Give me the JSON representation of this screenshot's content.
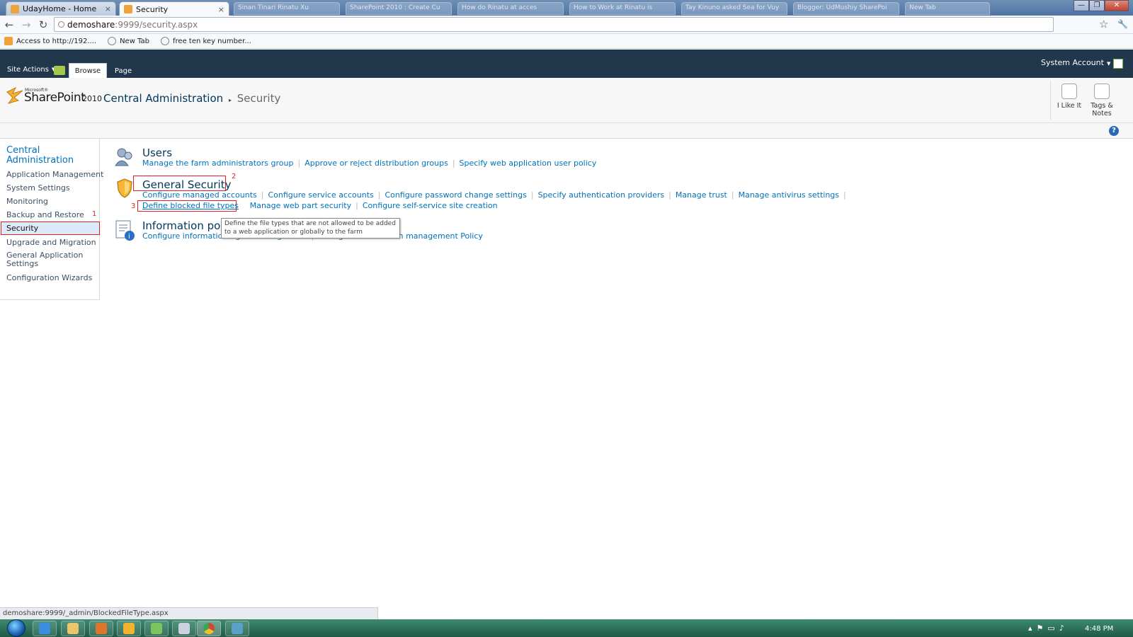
{
  "browser": {
    "tabs": [
      {
        "title": "UdayHome - Home",
        "close": "×"
      },
      {
        "title": "Security",
        "close": "×"
      }
    ],
    "background_tabs": [
      "Sinan Tinari Rinatu Xu",
      "SharePoint 2010 : Create Cu",
      "How do Rinatu at acces",
      "How to Work at Rinatu is",
      "Tay Kinuno asked Sea for Vuy",
      "Blogger: UdMushiy SharePoi",
      "New Tab"
    ],
    "window_buttons": [
      "—",
      "❐",
      "✕"
    ],
    "nav": {
      "back": "←",
      "forward": "→",
      "reload": "↻"
    },
    "url": {
      "host": "demoshare",
      "path": ":9999/security.aspx"
    },
    "star": "☆",
    "wrench": "🔧",
    "bookmarks": [
      "Access to http://192....",
      "New Tab",
      "free ten key number..."
    ]
  },
  "ribbon": {
    "site_actions": "Site Actions",
    "tabs": [
      "Browse",
      "Page"
    ],
    "account": "System Account"
  },
  "header": {
    "logo_small": "Microsoft®",
    "logo": "SharePoint",
    "logo_year": "2010",
    "breadcrumb_root": "Central Administration",
    "breadcrumb_sep": "▸",
    "breadcrumb_current": "Security",
    "i_like_it": "I Like It",
    "tags_notes_1": "Tags &",
    "tags_notes_2": "Notes",
    "help": "?"
  },
  "leftnav": {
    "heading": "Central Administration",
    "items": [
      "Application Management",
      "System Settings",
      "Monitoring",
      "Backup and Restore",
      "Security",
      "Upgrade and Migration",
      "General Application Settings",
      "Configuration Wizards"
    ],
    "annotation": "1"
  },
  "sections": {
    "users": {
      "title": "Users",
      "links": [
        "Manage the farm administrators group",
        "Approve or reject distribution groups",
        "Specify web application user policy"
      ]
    },
    "general_security": {
      "title": "General Security",
      "annotation": "2",
      "links_row1": [
        "Configure managed accounts",
        "Configure service accounts",
        "Configure password change settings",
        "Specify authentication providers",
        "Manage trust",
        "Manage antivirus settings"
      ],
      "annotation_row2": "3",
      "links_row2": [
        "Define blocked file types",
        "Manage web part security",
        "Configure self-service site creation"
      ]
    },
    "information_policy": {
      "title": "Information poli",
      "link1": "Configure information rights management",
      "link2": "Configure information management Policy"
    },
    "tooltip": "Define the file types that are not allowed to be added to a web application or globally to the farm"
  },
  "statusbar": "demoshare:9999/_admin/BlockedFileType.aspx",
  "taskbar": {
    "time": "4:48 PM"
  },
  "colors": {
    "ribbon_bg": "#21374c",
    "link": "#0072bc",
    "heading": "#003759",
    "annotation_red": "#e02020"
  }
}
